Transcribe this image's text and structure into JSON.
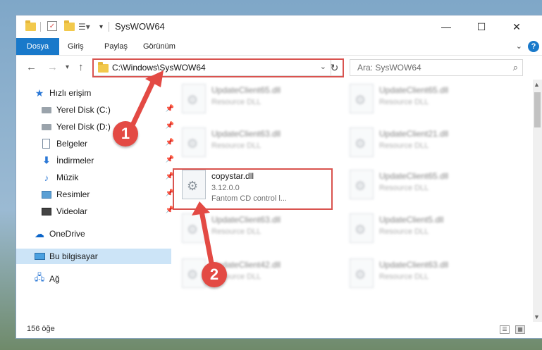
{
  "window": {
    "title": "SysWOW64",
    "controls": {
      "minimize": "—",
      "maximize": "☐",
      "close": "✕"
    }
  },
  "ribbon": {
    "tabs": [
      "Dosya",
      "Giriş",
      "Paylaş",
      "Görünüm"
    ],
    "help": "?"
  },
  "nav": {
    "address": "C:\\Windows\\SysWOW64",
    "search_placeholder": "Ara: SysWOW64"
  },
  "sidebar": {
    "items": [
      {
        "label": "Hızlı erişim",
        "icon": "star-icon"
      },
      {
        "label": "Yerel Disk (C:)",
        "icon": "drive-icon"
      },
      {
        "label": "Yerel Disk (D:)",
        "icon": "drive-icon"
      },
      {
        "label": "Belgeler",
        "icon": "document-icon"
      },
      {
        "label": "İndirmeler",
        "icon": "download-icon"
      },
      {
        "label": "Müzik",
        "icon": "music-icon"
      },
      {
        "label": "Resimler",
        "icon": "pictures-icon"
      },
      {
        "label": "Videolar",
        "icon": "videos-icon"
      },
      {
        "label": "OneDrive",
        "icon": "cloud-icon"
      },
      {
        "label": "Bu bilgisayar",
        "icon": "computer-icon"
      },
      {
        "label": "Ağ",
        "icon": "network-icon"
      }
    ]
  },
  "files": {
    "left": [
      {
        "name": "UpdateClient65.dll",
        "type": "Resource DLL"
      },
      {
        "name": "UpdateClient63.dll",
        "type": "Resource DLL"
      },
      {
        "name": "copystar.dll",
        "version": "3.12.0.0",
        "description": "Fantom CD control l..."
      },
      {
        "name": "UpdateClient63.dll",
        "type": "Resource DLL"
      },
      {
        "name": "UpdateClient42.dll",
        "type": "Resource DLL"
      }
    ],
    "right": [
      {
        "name": "UpdateClient65.dll",
        "type": "Resource DLL"
      },
      {
        "name": "UpdateClient21.dll",
        "type": "Resource DLL"
      },
      {
        "name": "UpdateClient65.dll",
        "type": "Resource DLL"
      },
      {
        "name": "UpdateClient5.dll",
        "type": "Resource DLL"
      },
      {
        "name": "UpdateClient63.dll",
        "type": "Resource DLL"
      }
    ]
  },
  "status": {
    "count": "156 öğe"
  },
  "annotations": {
    "callout1": "1",
    "callout2": "2",
    "color": "#e34a44"
  }
}
